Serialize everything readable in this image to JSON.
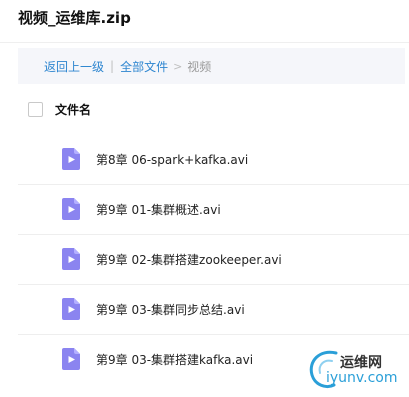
{
  "window": {
    "title": "视频_运维库.zip"
  },
  "breadcrumb": {
    "back": "返回上一级",
    "separator": "|",
    "all_files": "全部文件",
    "arrow": ">",
    "current": "视频"
  },
  "file_list": {
    "header_label": "文件名",
    "files": [
      {
        "name": "第8章 06-spark+kafka.avi",
        "icon": "video-file-icon"
      },
      {
        "name": "第9章 01-集群概述.avi",
        "icon": "video-file-icon"
      },
      {
        "name": "第9章 02-集群搭建zookeeper.avi",
        "icon": "video-file-icon"
      },
      {
        "name": "第9章 03-集群同步总结.avi",
        "icon": "video-file-icon"
      },
      {
        "name": "第9章 03-集群搭建kafka.avi",
        "icon": "video-file-icon"
      }
    ]
  },
  "watermark": {
    "name": "运维网",
    "domain": "iyunv.com"
  },
  "colors": {
    "link": "#2e86d0",
    "icon": "#8b84f0",
    "watermark_blue": "#2a9fd8"
  }
}
